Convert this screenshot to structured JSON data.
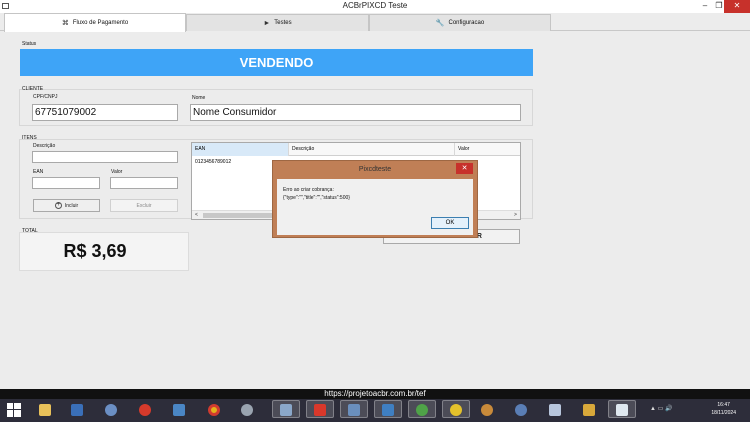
{
  "window": {
    "title": "ACBrPIXCD Teste",
    "minimize": "–",
    "restore": "❐",
    "close": "✕"
  },
  "tabs": [
    {
      "label": "Fluxo de Pagamento",
      "icon": "⌘"
    },
    {
      "label": "Testes",
      "icon": "►"
    },
    {
      "label": "Configuracao",
      "icon": "🔧"
    }
  ],
  "status": {
    "label": "Status",
    "value": "VENDENDO",
    "color": "#3ea4f7"
  },
  "cliente": {
    "group_label": "CLIENTE",
    "cpf_label": "CPF/CNPJ",
    "cpf_value": "67751079002",
    "nome_label": "Nome",
    "nome_value": "Nome Consumidor"
  },
  "itens": {
    "group_label": "ITENS",
    "descricao_label": "Descrição",
    "ean_label": "EAN",
    "valor_label": "Valor",
    "incluir_label": "Incluir",
    "excluir_label": "Excluir",
    "columns": [
      "EAN",
      "Descrição",
      "Valor"
    ],
    "rows": [
      {
        "ean": "0123456789012",
        "descricao": "",
        "valor": ""
      }
    ],
    "scroll_left": "<",
    "scroll_right": ">"
  },
  "total": {
    "label": "TOTAL",
    "value": "R$ 3,69"
  },
  "pagar": {
    "label": "PAGAR"
  },
  "dialog": {
    "title": "Pixcdteste",
    "close": "✕",
    "message_line1": "Erro ao criar cobrança:",
    "message_line2": "{\"type\":\"\",\"title\":\"\",\"status\":500}",
    "ok_label": "OK"
  },
  "overlay_url": "https://projetoacbr.com.br/tef",
  "taskbar": {
    "time": "16:47",
    "date": "18/11/2024",
    "tray_text": "▲ ▭ 🔊"
  }
}
